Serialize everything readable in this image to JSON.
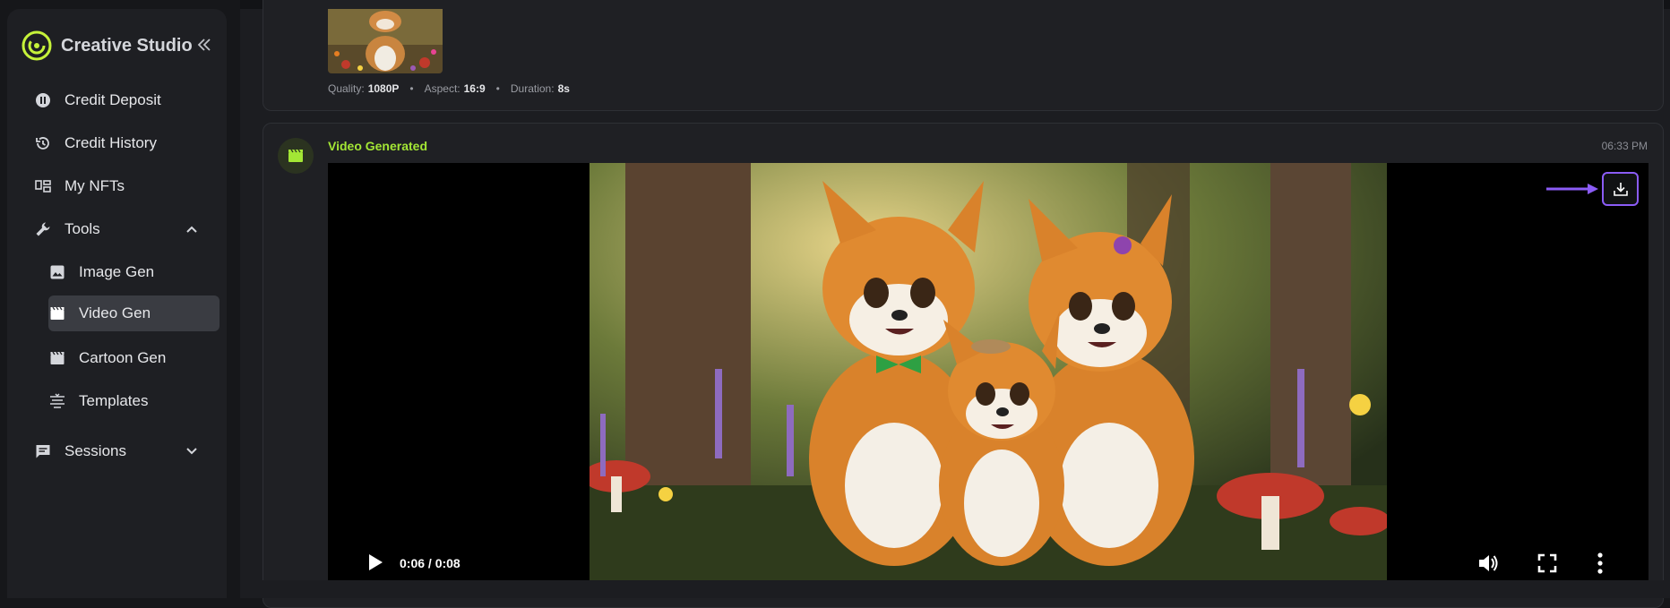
{
  "brand": {
    "name": "Creative Studio",
    "logo_icon": "logo-icon",
    "collapse_icon": "double-chevron-left-icon"
  },
  "nav": {
    "credit_deposit": "Credit Deposit",
    "credit_history": "Credit History",
    "my_nfts": "My NFTs",
    "tools": "Tools",
    "image_gen": "Image Gen",
    "video_gen": "Video Gen",
    "cartoon_gen": "Cartoon Gen",
    "templates": "Templates",
    "sessions": "Sessions",
    "active_item": "Video Gen"
  },
  "previous_card": {
    "quality_label": "Quality:",
    "quality_value": "1080P",
    "aspect_label": "Aspect:",
    "aspect_value": "16:9",
    "duration_label": "Duration:",
    "duration_value": "8s",
    "separator": "•"
  },
  "video_card": {
    "title": "Video Generated",
    "timestamp": "06:33 PM",
    "time_display": "0:06 / 0:08",
    "progress_fraction": 0.75
  },
  "colors": {
    "accent_green": "#a3e635",
    "highlight_purple": "#8b5cf6",
    "sidebar_bg": "#1e1f23",
    "active_bg": "#3a3c42"
  }
}
